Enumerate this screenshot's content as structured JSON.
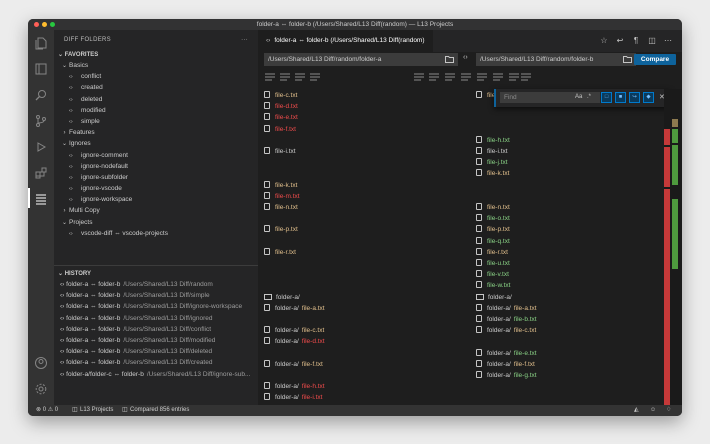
{
  "window": {
    "title": "folder-a ⇔ folder-b (/Users/Shared/L13 Diff(random) — L13 Projects"
  },
  "activity_bar": {
    "items": [
      "files-icon",
      "layout-icon",
      "search-icon",
      "source-control-icon",
      "run-icon",
      "extensions-icon",
      "diff-folders-icon"
    ],
    "bottom": [
      "account-icon",
      "settings-icon"
    ]
  },
  "sidebar": {
    "title": "DIFF FOLDERS",
    "more": "···",
    "favorites": {
      "label": "FAVORITES",
      "groups": [
        {
          "label": "Basics",
          "items": [
            "conflict",
            "created",
            "deleted",
            "modified",
            "simple"
          ]
        },
        {
          "label": "Features",
          "items": []
        },
        {
          "label": "Ignores",
          "items": [
            "ignore-comment",
            "ignore-nodefault",
            "ignore-subfolder",
            "ignore-vscode",
            "ignore-workspace"
          ]
        },
        {
          "label": "Multi Copy",
          "items": []
        },
        {
          "label": "Projects",
          "items": [
            "vscode-diff ⇔ vscode-projects"
          ]
        }
      ]
    },
    "history": {
      "label": "HISTORY",
      "items": [
        {
          "label": "folder-a ⇔ folder-b",
          "desc": "/Users/Shared/L13 Diff/random"
        },
        {
          "label": "folder-a ⇔ folder-b",
          "desc": "/Users/Shared/L13 Diff/simple"
        },
        {
          "label": "folder-a ⇔ folder-b",
          "desc": "/Users/Shared/L13 Diff/ignore-workspace"
        },
        {
          "label": "folder-a ⇔ folder-b",
          "desc": "/Users/Shared/L13 Diff/ignored"
        },
        {
          "label": "folder-a ⇔ folder-b",
          "desc": "/Users/Shared/L13 Diff/conflict"
        },
        {
          "label": "folder-a ⇔ folder-b",
          "desc": "/Users/Shared/L13 Diff/modified"
        },
        {
          "label": "folder-a ⇔ folder-b",
          "desc": "/Users/Shared/L13 Diff/deleted"
        },
        {
          "label": "folder-a ⇔ folder-b",
          "desc": "/Users/Shared/L13 Diff/created"
        },
        {
          "label": "folder-a/folder-c ⇔ folder-b",
          "desc": "/Users/Shared/L13 Diff/ignore-sub..."
        }
      ]
    }
  },
  "editor": {
    "tab_label": "folder-a ⇔ folder-b (/Users/Shared/L13 Diff(random)",
    "left_path": "/Users/Shared/L13 Diff/random/folder-a",
    "right_path": "/Users/Shared/L13 Diff/random/folder-b",
    "compare_label": "Compare",
    "swap_icon": "‹›",
    "find_placeholder": "Find",
    "find_case": "Aa",
    "find_regex": ".*"
  },
  "left_entries": [
    {
      "row": 0,
      "kind": "file",
      "prefix": "",
      "name": "file-c.txt",
      "status": "modified"
    },
    {
      "row": 1,
      "kind": "file",
      "prefix": "",
      "name": "file-d.txt",
      "status": "deleted"
    },
    {
      "row": 2,
      "kind": "file",
      "prefix": "",
      "name": "file-e.txt",
      "status": "deleted"
    },
    {
      "row": 3,
      "kind": "file",
      "prefix": "",
      "name": "file-f.txt",
      "status": "deleted"
    },
    {
      "row": 5,
      "kind": "file",
      "prefix": "",
      "name": "file-i.txt",
      "status": "same"
    },
    {
      "row": 8,
      "kind": "file",
      "prefix": "",
      "name": "file-k.txt",
      "status": "modified"
    },
    {
      "row": 9,
      "kind": "file",
      "prefix": "",
      "name": "file-m.txt",
      "status": "deleted"
    },
    {
      "row": 10,
      "kind": "file",
      "prefix": "",
      "name": "file-n.txt",
      "status": "modified"
    },
    {
      "row": 12,
      "kind": "file",
      "prefix": "",
      "name": "file-p.txt",
      "status": "modified"
    },
    {
      "row": 14,
      "kind": "file",
      "prefix": "",
      "name": "file-r.txt",
      "status": "modified"
    },
    {
      "row": 18,
      "kind": "folder",
      "prefix": "folder-a/",
      "name": "",
      "status": "path"
    },
    {
      "row": 19,
      "kind": "file",
      "prefix": "folder-a/",
      "name": "file-a.txt",
      "status": "modified"
    },
    {
      "row": 21,
      "kind": "file",
      "prefix": "folder-a/",
      "name": "file-c.txt",
      "status": "modified"
    },
    {
      "row": 22,
      "kind": "file",
      "prefix": "folder-a/",
      "name": "file-d.txt",
      "status": "deleted"
    },
    {
      "row": 24,
      "kind": "file",
      "prefix": "folder-a/",
      "name": "file-f.txt",
      "status": "modified"
    },
    {
      "row": 26,
      "kind": "file",
      "prefix": "folder-a/",
      "name": "file-h.txt",
      "status": "deleted"
    },
    {
      "row": 27,
      "kind": "file",
      "prefix": "folder-a/",
      "name": "file-i.txt",
      "status": "deleted"
    }
  ],
  "right_entries": [
    {
      "row": 0,
      "kind": "file",
      "prefix": "",
      "name": "file-c.txt",
      "status": "modified"
    },
    {
      "row": 4,
      "kind": "file",
      "prefix": "",
      "name": "file-h.txt",
      "status": "created"
    },
    {
      "row": 5,
      "kind": "file",
      "prefix": "",
      "name": "file-i.txt",
      "status": "same"
    },
    {
      "row": 6,
      "kind": "file",
      "prefix": "",
      "name": "file-j.txt",
      "status": "created"
    },
    {
      "row": 7,
      "kind": "file",
      "prefix": "",
      "name": "file-k.txt",
      "status": "modified"
    },
    {
      "row": 10,
      "kind": "file",
      "prefix": "",
      "name": "file-n.txt",
      "status": "modified"
    },
    {
      "row": 11,
      "kind": "file",
      "prefix": "",
      "name": "file-o.txt",
      "status": "created"
    },
    {
      "row": 12,
      "kind": "file",
      "prefix": "",
      "name": "file-p.txt",
      "status": "modified"
    },
    {
      "row": 13,
      "kind": "file",
      "prefix": "",
      "name": "file-q.txt",
      "status": "created"
    },
    {
      "row": 14,
      "kind": "file",
      "prefix": "",
      "name": "file-r.txt",
      "status": "modified"
    },
    {
      "row": 15,
      "kind": "file",
      "prefix": "",
      "name": "file-u.txt",
      "status": "created"
    },
    {
      "row": 16,
      "kind": "file",
      "prefix": "",
      "name": "file-v.txt",
      "status": "created"
    },
    {
      "row": 17,
      "kind": "file",
      "prefix": "",
      "name": "file-w.txt",
      "status": "created"
    },
    {
      "row": 18,
      "kind": "folder",
      "prefix": "folder-a/",
      "name": "",
      "status": "path"
    },
    {
      "row": 19,
      "kind": "file",
      "prefix": "folder-a/",
      "name": "file-a.txt",
      "status": "modified"
    },
    {
      "row": 20,
      "kind": "file",
      "prefix": "folder-a/",
      "name": "file-b.txt",
      "status": "created"
    },
    {
      "row": 21,
      "kind": "file",
      "prefix": "folder-a/",
      "name": "file-c.txt",
      "status": "modified"
    },
    {
      "row": 23,
      "kind": "file",
      "prefix": "folder-a/",
      "name": "file-e.txt",
      "status": "created"
    },
    {
      "row": 24,
      "kind": "file",
      "prefix": "folder-a/",
      "name": "file-f.txt",
      "status": "modified"
    },
    {
      "row": 25,
      "kind": "file",
      "prefix": "folder-a/",
      "name": "file-g.txt",
      "status": "created"
    }
  ],
  "status_colors": {
    "same": "#cccccc",
    "deleted": "#f14c4c",
    "created": "#89d185",
    "modified": "#e2c08d",
    "accent": "#0e639c"
  },
  "statusbar": {
    "problems": "⊗ 0 ⚠ 0",
    "workspace": "L13 Projects",
    "compared": "Compared 856 entries"
  }
}
